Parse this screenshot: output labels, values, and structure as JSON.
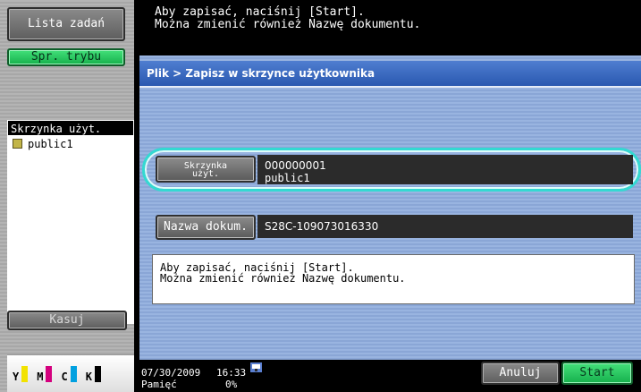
{
  "left_panel": {
    "job_list_button": "Lista zadań",
    "mode_check_button": "Spr. trybu",
    "box_header": "Skrzynka użyt.",
    "box_items": [
      "public1"
    ],
    "delete_button": "Kasuj",
    "toner": {
      "labels": [
        "Y",
        "M",
        "C",
        "K"
      ],
      "colors": [
        "#f2e200",
        "#d4007e",
        "#00a0e0",
        "#000000"
      ]
    }
  },
  "top_message": {
    "line1": "Aby zapisać, naciśnij [Start].",
    "line2": "Można zmienić również Nazwę dokumentu."
  },
  "breadcrumb": "Plik > Zapisz w skrzynce użytkownika",
  "user_box_field": {
    "button_label_line1": "Skrzynka",
    "button_label_line2": "użyt.",
    "value_number": "000000001",
    "value_name": "public1"
  },
  "document_name_field": {
    "button_label": "Nazwa dokum.",
    "value": "S28C-109073016330"
  },
  "message_box": {
    "line1": "Aby zapisać, naciśnij [Start].",
    "line2": "Można zmienić również Nazwę dokumentu."
  },
  "status_bar": {
    "date": "07/30/2009",
    "time": "16:33",
    "memory_label": "Pamięć",
    "memory_value": "0%",
    "cancel_button": "Anuluj",
    "start_button": "Start"
  },
  "colors": {
    "highlight": "#34d9d2",
    "breadcrumb_bg": "#2f5fb6",
    "start_green": "#16b04c"
  }
}
